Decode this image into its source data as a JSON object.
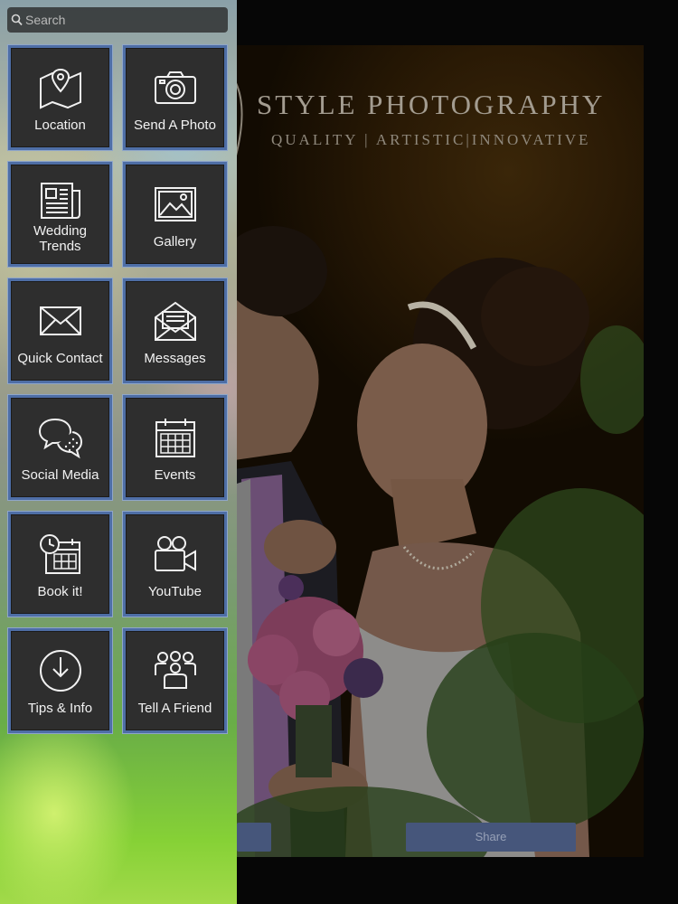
{
  "search": {
    "placeholder": "Search"
  },
  "brand": {
    "title": "STYLE PHOTOGRAPHY",
    "tagline": "QUALITY | ARTISTIC|INNOVATIVE"
  },
  "buttons": {
    "share_label": "Share"
  },
  "menu": [
    {
      "label": "Location",
      "icon": "map-pin-icon"
    },
    {
      "label": "Send A Photo",
      "icon": "camera-icon"
    },
    {
      "label": "Wedding\nTrends",
      "icon": "newspaper-icon"
    },
    {
      "label": "Gallery",
      "icon": "picture-icon"
    },
    {
      "label": "Quick Contact",
      "icon": "envelope-icon"
    },
    {
      "label": "Messages",
      "icon": "open-envelope-icon"
    },
    {
      "label": "Social Media",
      "icon": "speech-bubbles-icon"
    },
    {
      "label": "Events",
      "icon": "calendar-icon"
    },
    {
      "label": "Book it!",
      "icon": "calendar-clock-icon"
    },
    {
      "label": "YouTube",
      "icon": "video-camera-icon"
    },
    {
      "label": "Tips & Info",
      "icon": "download-circle-icon"
    },
    {
      "label": "Tell A Friend",
      "icon": "people-icon"
    }
  ]
}
